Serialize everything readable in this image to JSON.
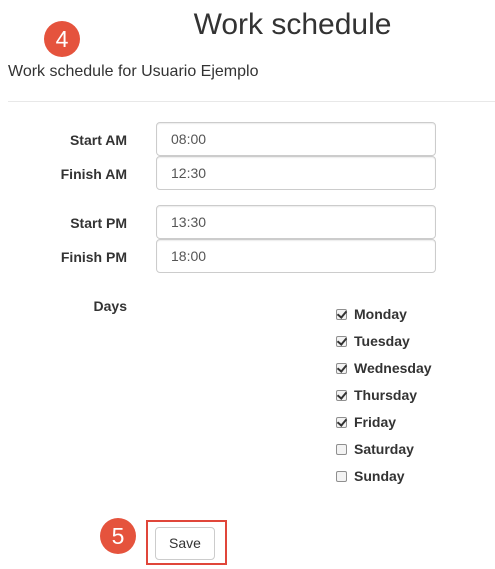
{
  "page": {
    "title": "Work schedule",
    "subtitle": "Work schedule for Usuario Ejemplo"
  },
  "annotations": {
    "step_top": "4",
    "step_bottom": "5",
    "badge_color": "#e5533d",
    "highlight_color": "#e0463a"
  },
  "schedule": {
    "start_am": {
      "label": "Start AM",
      "value": "08:00"
    },
    "finish_am": {
      "label": "Finish AM",
      "value": "12:30"
    },
    "start_pm": {
      "label": "Start PM",
      "value": "13:30"
    },
    "finish_pm": {
      "label": "Finish PM",
      "value": "18:00"
    }
  },
  "days": {
    "label": "Days",
    "items": [
      {
        "label": "Monday",
        "checked": true
      },
      {
        "label": "Tuesday",
        "checked": true
      },
      {
        "label": "Wednesday",
        "checked": true
      },
      {
        "label": "Thursday",
        "checked": true
      },
      {
        "label": "Friday",
        "checked": true
      },
      {
        "label": "Saturday",
        "checked": false
      },
      {
        "label": "Sunday",
        "checked": false
      }
    ]
  },
  "actions": {
    "save_label": "Save"
  }
}
